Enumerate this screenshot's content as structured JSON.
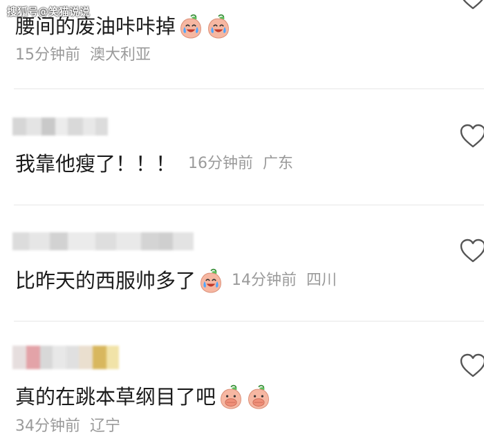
{
  "watermark": "搜狐号@笑猫说说",
  "comments": [
    {
      "text": "腰间的废油咔咔掉",
      "emojis": [
        "cry-laugh-peach-icon",
        "cry-laugh-peach-icon"
      ],
      "time": "15分钟前",
      "location": "澳大利亚"
    },
    {
      "text": "我靠他瘦了！！！",
      "emojis": [],
      "time": "16分钟前",
      "location": "广东"
    },
    {
      "text": "比昨天的西服帅多了",
      "emojis": [
        "cry-laugh-peach-icon"
      ],
      "time": "14分钟前",
      "location": "四川"
    },
    {
      "text": "真的在跳本草纲目了吧",
      "emojis": [
        "cover-mouth-peach-icon",
        "cover-mouth-peach-icon"
      ],
      "time": "34分钟前",
      "location": "辽宁"
    }
  ],
  "colors": {
    "text": "#1b1b1b",
    "meta": "#9a9a9a",
    "divider": "#e6e6e6",
    "heart_stroke": "#555555",
    "peach": "#f7b9a3",
    "leaf": "#4caf50"
  },
  "icons": [
    "heart-outline-icon",
    "cry-laugh-peach-icon",
    "cover-mouth-peach-icon"
  ]
}
